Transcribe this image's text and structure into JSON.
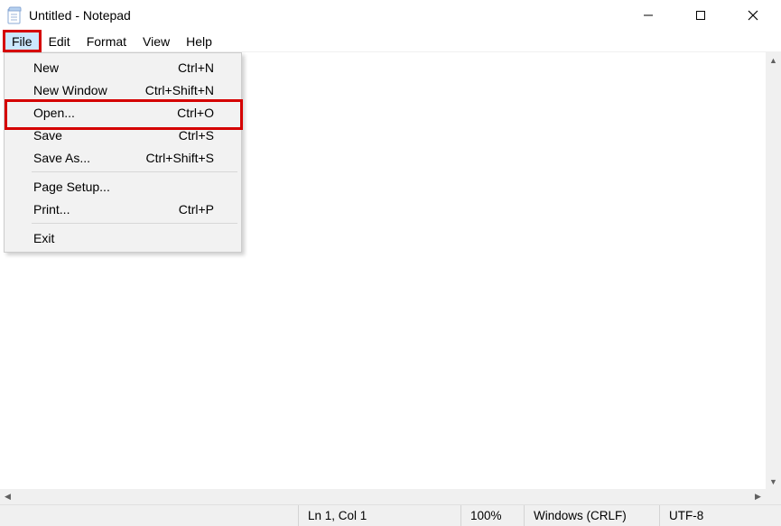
{
  "window": {
    "title": "Untitled - Notepad"
  },
  "menubar": {
    "items": [
      {
        "label": "File",
        "active": true
      },
      {
        "label": "Edit",
        "active": false
      },
      {
        "label": "Format",
        "active": false
      },
      {
        "label": "View",
        "active": false
      },
      {
        "label": "Help",
        "active": false
      }
    ]
  },
  "file_menu": {
    "items": [
      {
        "label": "New",
        "shortcut": "Ctrl+N",
        "type": "item"
      },
      {
        "label": "New Window",
        "shortcut": "Ctrl+Shift+N",
        "type": "item"
      },
      {
        "label": "Open...",
        "shortcut": "Ctrl+O",
        "type": "item",
        "highlighted": true
      },
      {
        "label": "Save",
        "shortcut": "Ctrl+S",
        "type": "item"
      },
      {
        "label": "Save As...",
        "shortcut": "Ctrl+Shift+S",
        "type": "item"
      },
      {
        "type": "sep"
      },
      {
        "label": "Page Setup...",
        "shortcut": "",
        "type": "item"
      },
      {
        "label": "Print...",
        "shortcut": "Ctrl+P",
        "type": "item"
      },
      {
        "type": "sep"
      },
      {
        "label": "Exit",
        "shortcut": "",
        "type": "item"
      }
    ]
  },
  "status": {
    "cursor": "Ln 1, Col 1",
    "zoom": "100%",
    "line_ending": "Windows (CRLF)",
    "encoding": "UTF-8"
  },
  "highlights": {
    "file_menu_button": true,
    "open_item": true
  }
}
